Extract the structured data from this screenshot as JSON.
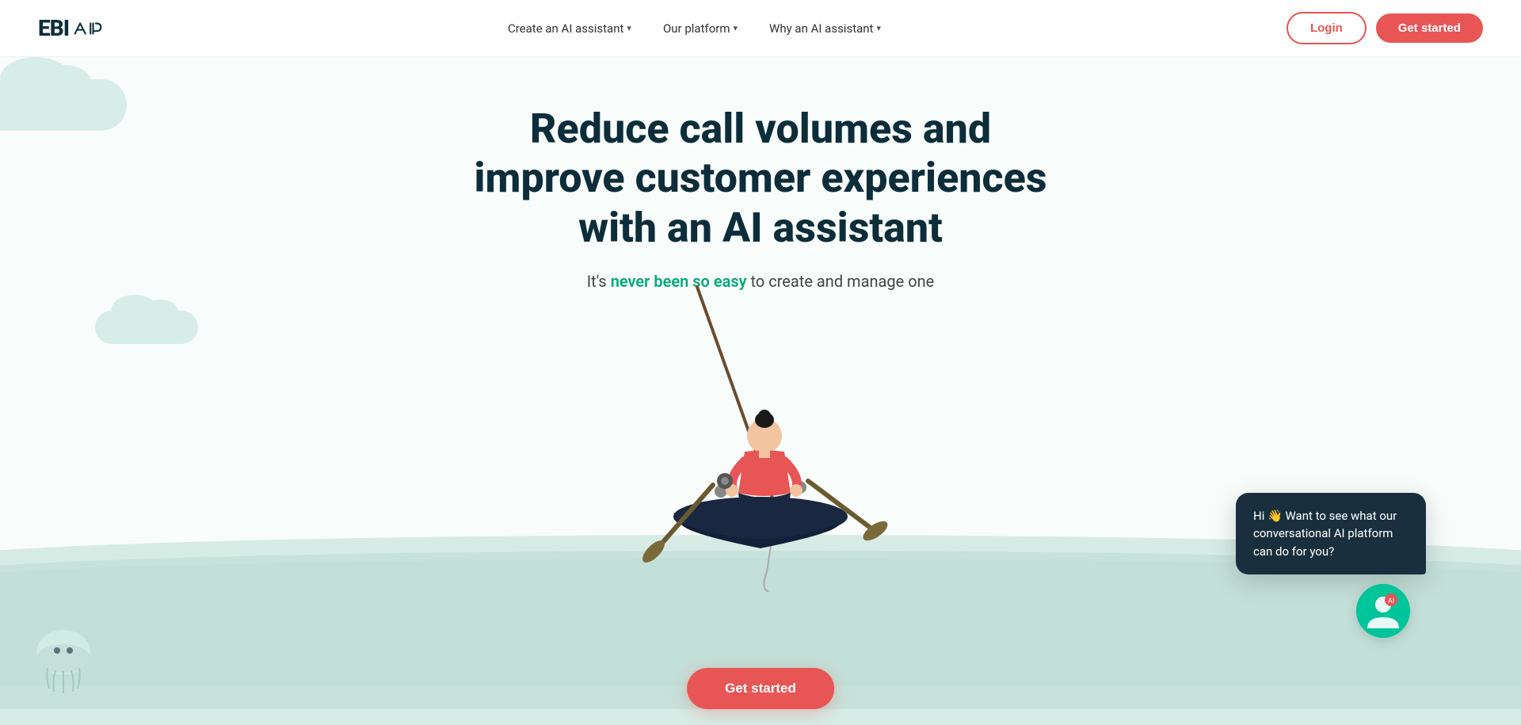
{
  "logo": {
    "text": "EBI",
    "icon_label": "AI logo mark"
  },
  "nav": {
    "items": [
      {
        "label": "Create an AI assistant",
        "has_dropdown": true
      },
      {
        "label": "Our platform",
        "has_dropdown": true
      },
      {
        "label": "Why an AI assistant",
        "has_dropdown": true
      }
    ]
  },
  "header": {
    "login_label": "Login",
    "get_started_label": "Get started"
  },
  "hero": {
    "title": "Reduce call volumes and improve customer experiences with an AI assistant",
    "subtitle_start": "It's ",
    "subtitle_highlight": "never been so easy",
    "subtitle_end": " to create and manage one"
  },
  "chat": {
    "bubble_text": "Hi 👋 Want to see what our conversational AI platform can do for you?"
  },
  "cta": {
    "label": "Get started"
  }
}
